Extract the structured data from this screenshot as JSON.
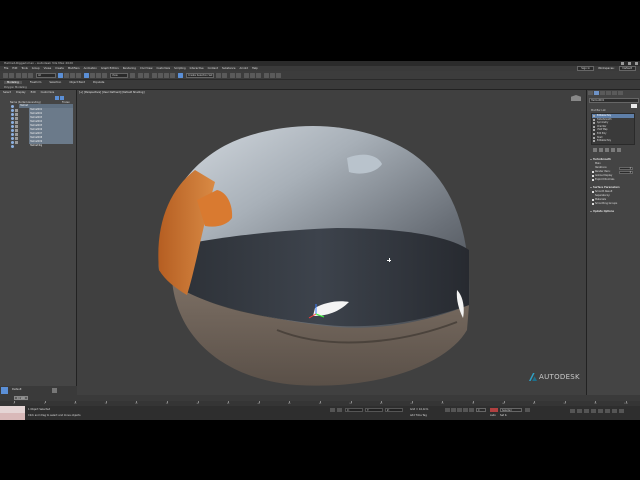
{
  "window": {
    "title": "Helmet-Rigged.max  - Autodesk 3ds Max 2020",
    "controls": [
      "minimize-icon",
      "maximize-icon",
      "close-icon"
    ]
  },
  "menubar": {
    "items": [
      "File",
      "Edit",
      "Tools",
      "Group",
      "Views",
      "Create",
      "Modifiers",
      "Animation",
      "Graph Editors",
      "Rendering",
      "Civil View",
      "Customize",
      "Scripting",
      "Interactive",
      "Content",
      "Substance",
      "Arnold",
      "Help"
    ],
    "sign_in": "Sign In",
    "workspaces_label": "Workspaces:",
    "workspace_value": "Default"
  },
  "toolbar": {
    "selection_filter": "All",
    "view_field": "View",
    "named_selection": "Create Selection Set"
  },
  "ribbon": {
    "tabs": [
      "Modeling",
      "Freeform",
      "Selection",
      "Object Paint",
      "Populate"
    ],
    "active_tab": "Modeling",
    "subtitle": "Polygon Modeling"
  },
  "scene_explorer": {
    "menu": [
      "Select",
      "Display",
      "Edit",
      "Customize"
    ],
    "header_name": "Name (Sorted Ascending)",
    "header_frozen": "Frozen",
    "root": "Helmet",
    "items": [
      "Helmet001",
      "Helmet002",
      "Helmet003",
      "Helmet004",
      "Helmet005",
      "Helmet006",
      "Helmet007",
      "Helmet008",
      "Helmet009",
      "Helmet Rig"
    ],
    "layer_label": "Default"
  },
  "viewport": {
    "label": "[+] [Perspective] [User Defined] [Default Shading]",
    "brand": "AUTODESK"
  },
  "command_panel": {
    "object_name": "Helmet001",
    "modifier_list_label": "Modifier List",
    "stack": [
      "Editable Poly",
      "TurboSmooth",
      "Symmetry",
      "Chamfer",
      "UVW Map",
      "Edit Poly",
      "Shell",
      "Editable Poly"
    ],
    "rollouts": {
      "turbosmooth": "TurboSmooth",
      "main": "Main",
      "iterations_label": "Iterations:",
      "iterations_value": "2",
      "render_iters_label": "Render Iters:",
      "render_iters_value": "2",
      "isoline_display": "Isoline Display",
      "explicit_normals": "Explicit Normals",
      "surface_params": "Surface Parameters",
      "smooth_result": "Smooth Result",
      "separate_by": "Separate by:",
      "materials": "Materials",
      "smoothing_groups": "Smoothing Groups",
      "update_options": "Update Options"
    }
  },
  "timeline": {
    "slider_label": "0 / 100",
    "ticks": [
      "0",
      "5",
      "10",
      "15",
      "20",
      "25",
      "30",
      "35",
      "40",
      "45",
      "50",
      "55",
      "60",
      "65",
      "70",
      "75",
      "80",
      "85",
      "90",
      "95",
      "100"
    ]
  },
  "statusbar": {
    "selection_status": "1 Object Selected",
    "prompt": "Click and drag to select and move objects",
    "x_label": "X:",
    "x_value": "",
    "y_label": "Y:",
    "y_value": "",
    "z_label": "Z:",
    "z_value": "",
    "grid": "Grid = 10,0cm",
    "add_time_tag": "Add Time Tag",
    "auto_key": "Auto",
    "set_key": "Set K.",
    "selected": "Selected",
    "frame": "0"
  },
  "colors": {
    "accent_blue": "#5b8fd6",
    "helmet_orange": "#c46a2a",
    "viewport_bg": "#404040"
  }
}
